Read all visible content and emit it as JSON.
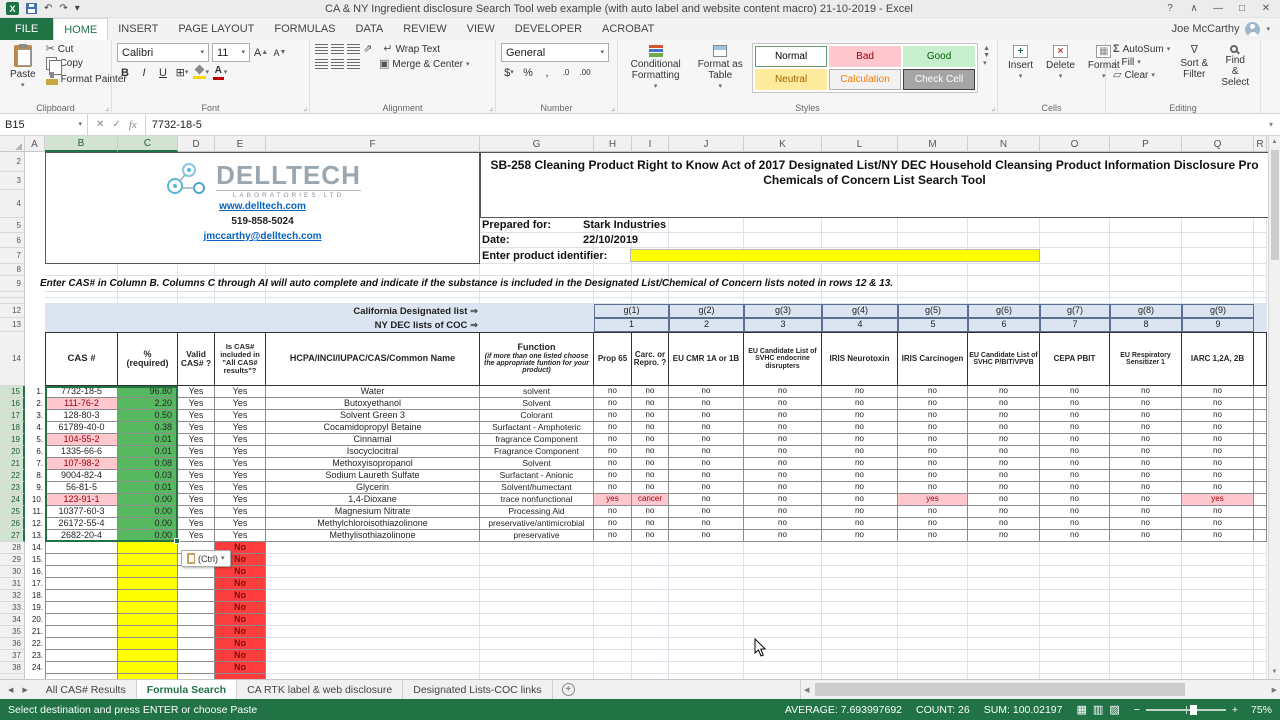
{
  "colors": {
    "accent_green": "#217346",
    "band_blue": "#dbe5f1",
    "flag_pink_bg": "#ffc7ce",
    "flag_pink_fg": "#9c0006",
    "pct_green": "#56b960",
    "input_yellow": "#ffff00",
    "missing_red_bg": "#fc3d3d"
  },
  "icons": {
    "caret": "▾",
    "cut": "✂",
    "border": "⊞",
    "wrap": "↵",
    "merge": "▣",
    "orientation": "⇗",
    "autosum": "Σ",
    "fill_down": "↓",
    "clear": "▱",
    "sort": "∇",
    "undo": "↶",
    "redo": "↷",
    "help": "?",
    "ribbon_display": "∧",
    "min": "—",
    "max": "□",
    "close": "✕",
    "left_nav": "◀",
    "right_nav": "▶",
    "plus": "+",
    "up": "▲",
    "down": "▼",
    "launcher": "⌟",
    "check": "✓",
    "x": "✕",
    "view_normal": "▦",
    "view_layout": "▥",
    "view_break": "▨",
    "minus": "−",
    "dollar": "$",
    "percent": "%",
    "comma": ",",
    "dec0": ".0",
    "dec00": ".00"
  },
  "title_bar": {
    "title": "CA & NY Ingredient disclosure Search Tool web example (with auto label and website content macro) 21-10-2019 - Excel"
  },
  "tab_row": {
    "file": "FILE",
    "tabs": [
      "HOME",
      "INSERT",
      "PAGE LAYOUT",
      "FORMULAS",
      "DATA",
      "REVIEW",
      "VIEW",
      "DEVELOPER",
      "ACROBAT"
    ],
    "active_tab": "HOME",
    "user": "Joe McCarthy"
  },
  "ribbon": {
    "clipboard": {
      "label": "Clipboard",
      "paste": "Paste",
      "cut": "Cut",
      "copy": "Copy",
      "format_painter": "Format Painter"
    },
    "font": {
      "label": "Font",
      "family": "Calibri",
      "size": "11",
      "bold": "B",
      "italic": "I",
      "underline": "U"
    },
    "alignment": {
      "label": "Alignment",
      "wrap_text": "Wrap Text",
      "merge_center": "Merge & Center"
    },
    "number": {
      "label": "Number",
      "format": "General"
    },
    "styles": {
      "label": "Styles",
      "conditional": "Conditional Formatting",
      "format_table": "Format as Table",
      "cell_styles": [
        "Normal",
        "Bad",
        "Good",
        "Neutral",
        "Calculation",
        "Check Cell"
      ]
    },
    "cells": {
      "label": "Cells",
      "insert": "Insert",
      "delete": "Delete",
      "format": "Format"
    },
    "editing": {
      "label": "Editing",
      "autosum": "AutoSum",
      "fill": "Fill",
      "clear": "Clear",
      "sort_filter": "Sort & Filter",
      "find_select": "Find & Select"
    }
  },
  "formula_bar": {
    "name_box": "B15",
    "fx": "fx",
    "value": "7732-18-5"
  },
  "sheet": {
    "columns": [
      "A",
      "B",
      "C",
      "D",
      "E",
      "F",
      "G",
      "H",
      "I",
      "J",
      "K",
      "L",
      "M",
      "N",
      "O",
      "P",
      "Q",
      "R"
    ],
    "row_range": [
      2,
      39
    ],
    "info_box": {
      "logo_text": "DELLTECH",
      "logo_sub": "LABORATORIES LTD",
      "website": "www.delltech.com",
      "phone": "519-858-5024",
      "email": "jmccarthy@delltech.com"
    },
    "title_line1": "SB-258 Cleaning Product Right to Know Act of 2017 Designated List/NY DEC Household Cleansing Product Information Disclosure Pro",
    "title_line2": "Chemicals of Concern List Search Tool",
    "prepared_for_label": "Prepared for:",
    "prepared_for": "Stark Industries",
    "date_label": "Date:",
    "date_value": "22/10/2019",
    "product_id_label": "Enter product identifier:",
    "instructions": "Enter CAS# in Column B. Columns C through AI will auto complete and indicate if the  substance is included in the Designated List/Chemical of Concern lists noted in rows 12 & 13.",
    "ca_list_label": "California Designated list ⇒",
    "ny_list_label": "NY DEC lists of COC ⇒",
    "g_headers": [
      "g(1)",
      "g(2)",
      "g(3)",
      "g(4)",
      "g(5)",
      "g(6)",
      "g(7)",
      "g(8)",
      "g(9)"
    ],
    "g_numbers": [
      "1",
      "2",
      "3",
      "4",
      "5",
      "6",
      "7",
      "8",
      "9"
    ],
    "table_headers": {
      "cas": "CAS #",
      "pct_line1": "%",
      "pct_line2": "(required)",
      "valid": "Valid CAS# ?",
      "included": "Is CAS# included  in \"All CAS# results\"?",
      "name": "HCPA/INCI/IUPAC/CAS/Common Name",
      "function_title": "Function",
      "function_note": "(if more than one listed choose the appropriate funtion for your product)",
      "flags": [
        "Prop 65",
        "Carc. or Repro. ?",
        "EU CMR 1A or 1B",
        "EU Candidate List of SVHC endocrine disrupters",
        "IRIS Neurotoxin",
        "IRIS Carcinogen",
        "EU Candidate List of SVHC P/BIT/VPVB",
        "CEPA PBIT",
        "EU Respiratory Sensitizer 1",
        "IARC 1,2A, 2B"
      ]
    },
    "rows": [
      {
        "num": "1.",
        "cas": "7732-18-5",
        "alert": false,
        "pct": "96.80",
        "valid": "Yes",
        "included": "Yes",
        "name": "Water",
        "function": "solvent",
        "flags": [
          "no",
          "no",
          "no",
          "no",
          "no",
          "no",
          "no",
          "no",
          "no",
          "no"
        ]
      },
      {
        "num": "2.",
        "cas": "111-76-2",
        "alert": true,
        "pct": "2.20",
        "valid": "Yes",
        "included": "Yes",
        "name": "Butoxyethanol",
        "function": "Solvent",
        "flags": [
          "no",
          "no",
          "no",
          "no",
          "no",
          "no",
          "no",
          "no",
          "no",
          "no"
        ]
      },
      {
        "num": "3.",
        "cas": "128-80-3",
        "alert": false,
        "pct": "0.50",
        "valid": "Yes",
        "included": "Yes",
        "name": "Solvent Green 3",
        "function": "Colorant",
        "flags": [
          "no",
          "no",
          "no",
          "no",
          "no",
          "no",
          "no",
          "no",
          "no",
          "no"
        ]
      },
      {
        "num": "4.",
        "cas": "61789-40-0",
        "alert": false,
        "pct": "0.38",
        "valid": "Yes",
        "included": "Yes",
        "name": "Cocamidopropyl Betaine",
        "function": "Surfactant - Amphoteric",
        "flags": [
          "no",
          "no",
          "no",
          "no",
          "no",
          "no",
          "no",
          "no",
          "no",
          "no"
        ]
      },
      {
        "num": "5.",
        "cas": "104-55-2",
        "alert": true,
        "pct": "0.01",
        "valid": "Yes",
        "included": "Yes",
        "name": "Cinnamal",
        "function": "fragrance Component",
        "flags": [
          "no",
          "no",
          "no",
          "no",
          "no",
          "no",
          "no",
          "no",
          "no",
          "no"
        ]
      },
      {
        "num": "6.",
        "cas": "1335-66-6",
        "alert": false,
        "pct": "0.01",
        "valid": "Yes",
        "included": "Yes",
        "name": "Isocyclocitral",
        "function": "Fragrance Component",
        "flags": [
          "no",
          "no",
          "no",
          "no",
          "no",
          "no",
          "no",
          "no",
          "no",
          "no"
        ]
      },
      {
        "num": "7.",
        "cas": "107-98-2",
        "alert": true,
        "pct": "0.08",
        "valid": "Yes",
        "included": "Yes",
        "name": "Methoxyisopropanol",
        "function": "Solvent",
        "flags": [
          "no",
          "no",
          "no",
          "no",
          "no",
          "no",
          "no",
          "no",
          "no",
          "no"
        ]
      },
      {
        "num": "8.",
        "cas": "9004-82-4",
        "alert": false,
        "pct": "0.03",
        "valid": "Yes",
        "included": "Yes",
        "name": "Sodium Laureth Sulfate",
        "function": "Surfactant - Anionic",
        "flags": [
          "no",
          "no",
          "no",
          "no",
          "no",
          "no",
          "no",
          "no",
          "no",
          "no"
        ]
      },
      {
        "num": "9.",
        "cas": "56-81-5",
        "alert": false,
        "pct": "0.01",
        "valid": "Yes",
        "included": "Yes",
        "name": "Glycerin",
        "function": "Solvent/humectant",
        "flags": [
          "no",
          "no",
          "no",
          "no",
          "no",
          "no",
          "no",
          "no",
          "no",
          "no"
        ]
      },
      {
        "num": "10.",
        "cas": "123-91-1",
        "alert": true,
        "pct": "0.00",
        "valid": "Yes",
        "included": "Yes",
        "name": "1,4-Dioxane",
        "function": "trace nonfunctional",
        "flags": [
          "yes",
          "cancer",
          "no",
          "no",
          "no",
          "yes",
          "no",
          "no",
          "no",
          "yes"
        ]
      },
      {
        "num": "11.",
        "cas": "10377-60-3",
        "alert": false,
        "pct": "0.00",
        "valid": "Yes",
        "included": "Yes",
        "name": "Magnesium Nitrate",
        "function": "Processing Aid",
        "flags": [
          "no",
          "no",
          "no",
          "no",
          "no",
          "no",
          "no",
          "no",
          "no",
          "no"
        ]
      },
      {
        "num": "12.",
        "cas": "26172-55-4",
        "alert": false,
        "pct": "0.00",
        "valid": "Yes",
        "included": "Yes",
        "name": "Methylchloroisothiazolinone",
        "function": "preservative/antimicrobial",
        "flags": [
          "no",
          "no",
          "no",
          "no",
          "no",
          "no",
          "no",
          "no",
          "no",
          "no"
        ]
      },
      {
        "num": "13.",
        "cas": "2682-20-4",
        "alert": false,
        "pct": "0.00",
        "valid": "Yes",
        "included": "Yes",
        "name": "Methylisothiazolinone",
        "function": "preservative",
        "flags": [
          "no",
          "no",
          "no",
          "no",
          "no",
          "no",
          "no",
          "no",
          "no",
          "no"
        ]
      }
    ],
    "pending": {
      "nums": [
        "14.",
        "15.",
        "16.",
        "17.",
        "18.",
        "19.",
        "20.",
        "21.",
        "22.",
        "23.",
        "24."
      ],
      "included_value": "No"
    }
  },
  "paste_options_label": "(Ctrl)",
  "sheet_tabs": {
    "tabs": [
      "All CAS# Results",
      "Formula Search",
      "CA RTK label & web disclosure",
      "Designated Lists-COC links"
    ],
    "active": "Formula Search"
  },
  "status_bar": {
    "message": "Select destination and press ENTER or choose Paste",
    "stats": [
      {
        "label": "AVERAGE:",
        "value": "7.693997692"
      },
      {
        "label": "COUNT:",
        "value": "26"
      },
      {
        "label": "SUM:",
        "value": "100.02197"
      }
    ],
    "zoom": "75%"
  }
}
